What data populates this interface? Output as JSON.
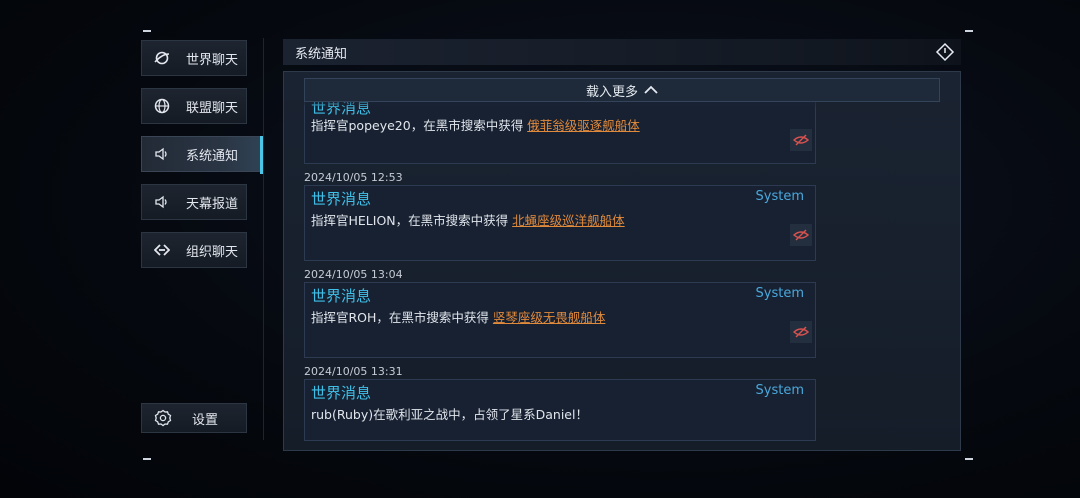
{
  "sidebar": {
    "items": [
      {
        "label": "世界聊天",
        "icon": "globe-ring-icon",
        "active": false
      },
      {
        "label": "联盟聊天",
        "icon": "globe-icon",
        "active": false
      },
      {
        "label": "系统通知",
        "icon": "speaker-icon",
        "active": true
      },
      {
        "label": "天幕报道",
        "icon": "speaker-icon",
        "active": false
      },
      {
        "label": "组织聊天",
        "icon": "diamond-link-icon",
        "active": false
      }
    ],
    "settings_label": "设置"
  },
  "header": {
    "title": "系统通知",
    "power_icon": "power-icon"
  },
  "load_more": "载入更多",
  "messages": [
    {
      "timestamp": "",
      "title": "世界消息",
      "system": "",
      "body_prefix": "指挥官popeye20，在黑市搜索中获得 ",
      "link": "俄菲翁级驱逐舰船体",
      "body_suffix": "",
      "hide_icon": true
    },
    {
      "timestamp": "2024/10/05 12:53",
      "title": "世界消息",
      "system": "System",
      "body_prefix": "指挥官HELION，在黑市搜索中获得 ",
      "link": "北蝇座级巡洋舰船体",
      "body_suffix": "",
      "hide_icon": true
    },
    {
      "timestamp": "2024/10/05 13:04",
      "title": "世界消息",
      "system": "System",
      "body_prefix": "指挥官ROH，在黑市搜索中获得 ",
      "link": "竖琴座级无畏舰船体",
      "body_suffix": "",
      "hide_icon": true
    },
    {
      "timestamp": "2024/10/05 13:31",
      "title": "世界消息",
      "system": "System",
      "body_prefix": "rub(Ruby)在歌利亚之战中，占领了星系Daniel！",
      "link": "",
      "body_suffix": "",
      "hide_icon": false
    }
  ],
  "colors": {
    "accent": "#4cc6e6",
    "title": "#3fc0e8",
    "link": "#e08a3c",
    "system": "#4aa8dc"
  }
}
